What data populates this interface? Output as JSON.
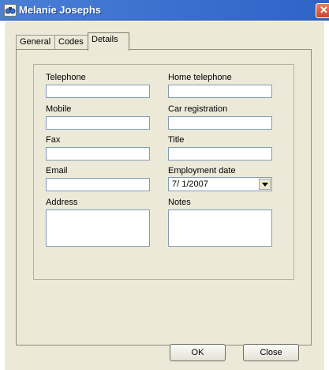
{
  "window": {
    "title": "Melanie Josephs",
    "app_icon": "binoculars-icon",
    "close_glyph": "✕"
  },
  "tabs": [
    {
      "label": "General",
      "active": false
    },
    {
      "label": "Codes",
      "active": false
    },
    {
      "label": "Details",
      "active": true
    }
  ],
  "details": {
    "telephone": {
      "label": "Telephone",
      "value": ""
    },
    "home_telephone": {
      "label": "Home telephone",
      "value": ""
    },
    "mobile": {
      "label": "Mobile",
      "value": ""
    },
    "car_registration": {
      "label": "Car registration",
      "value": ""
    },
    "fax": {
      "label": "Fax",
      "value": ""
    },
    "title": {
      "label": "Title",
      "value": ""
    },
    "email": {
      "label": "Email",
      "value": ""
    },
    "employment_date": {
      "label": "Employment date",
      "value": "7/ 1/2007"
    },
    "address": {
      "label": "Address",
      "value": ""
    },
    "notes": {
      "label": "Notes",
      "value": ""
    }
  },
  "buttons": {
    "ok": "OK",
    "close": "Close"
  },
  "colors": {
    "titlebar": "#3a6fcf",
    "dialog_face": "#ece9d8",
    "input_border": "#7f9db9",
    "close_button": "#c8472c"
  }
}
